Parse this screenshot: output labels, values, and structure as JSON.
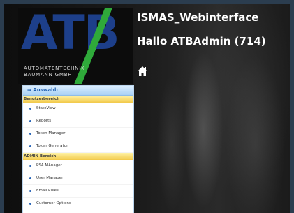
{
  "logo": {
    "letters": "ATB",
    "company_line1": "AUTOMATENTECHNIK",
    "company_line2": "BAUMANN GMBH"
  },
  "header": {
    "title": "ISMAS_Webinterface",
    "greeting": "Hallo ATBAdmin (714)",
    "home_icon": "home-icon"
  },
  "menu": {
    "header_label": "⇒ Auswahl:",
    "sections": [
      {
        "label": "Benutzerbereich",
        "items": [
          "StateView",
          "Reports",
          "Token Manager",
          "Token Generator"
        ]
      },
      {
        "label": "ADMIN Bereich",
        "items": [
          "PSA MAnager",
          "User Manager",
          "Email Rules",
          "Customer Options"
        ]
      }
    ]
  },
  "colors": {
    "logo_blue": "#1d3f8a",
    "logo_green": "#2faa3a",
    "menu_header_text": "#1f5fb1",
    "section_yellow": "#f2c94a",
    "bullet_blue": "#2a66b8"
  }
}
